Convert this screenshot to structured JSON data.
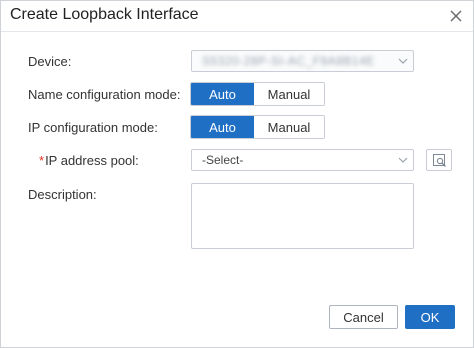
{
  "dialog": {
    "title": "Create Loopback Interface"
  },
  "form": {
    "device": {
      "label": "Device:",
      "value": "S5320-28P-SI-AC_F9A8B14E"
    },
    "name_mode": {
      "label": "Name configuration mode:",
      "options": [
        "Auto",
        "Manual"
      ],
      "selected": "Auto"
    },
    "ip_mode": {
      "label": "IP configuration mode:",
      "options": [
        "Auto",
        "Manual"
      ],
      "selected": "Auto"
    },
    "ip_pool": {
      "required_mark": "*",
      "label": "IP address pool:",
      "value": "-Select-",
      "search_icon": "search-list-icon"
    },
    "description": {
      "label": "Description:",
      "value": ""
    }
  },
  "footer": {
    "cancel_label": "Cancel",
    "ok_label": "OK"
  },
  "colors": {
    "accent": "#1f6fc5",
    "required": "#e0301e"
  }
}
